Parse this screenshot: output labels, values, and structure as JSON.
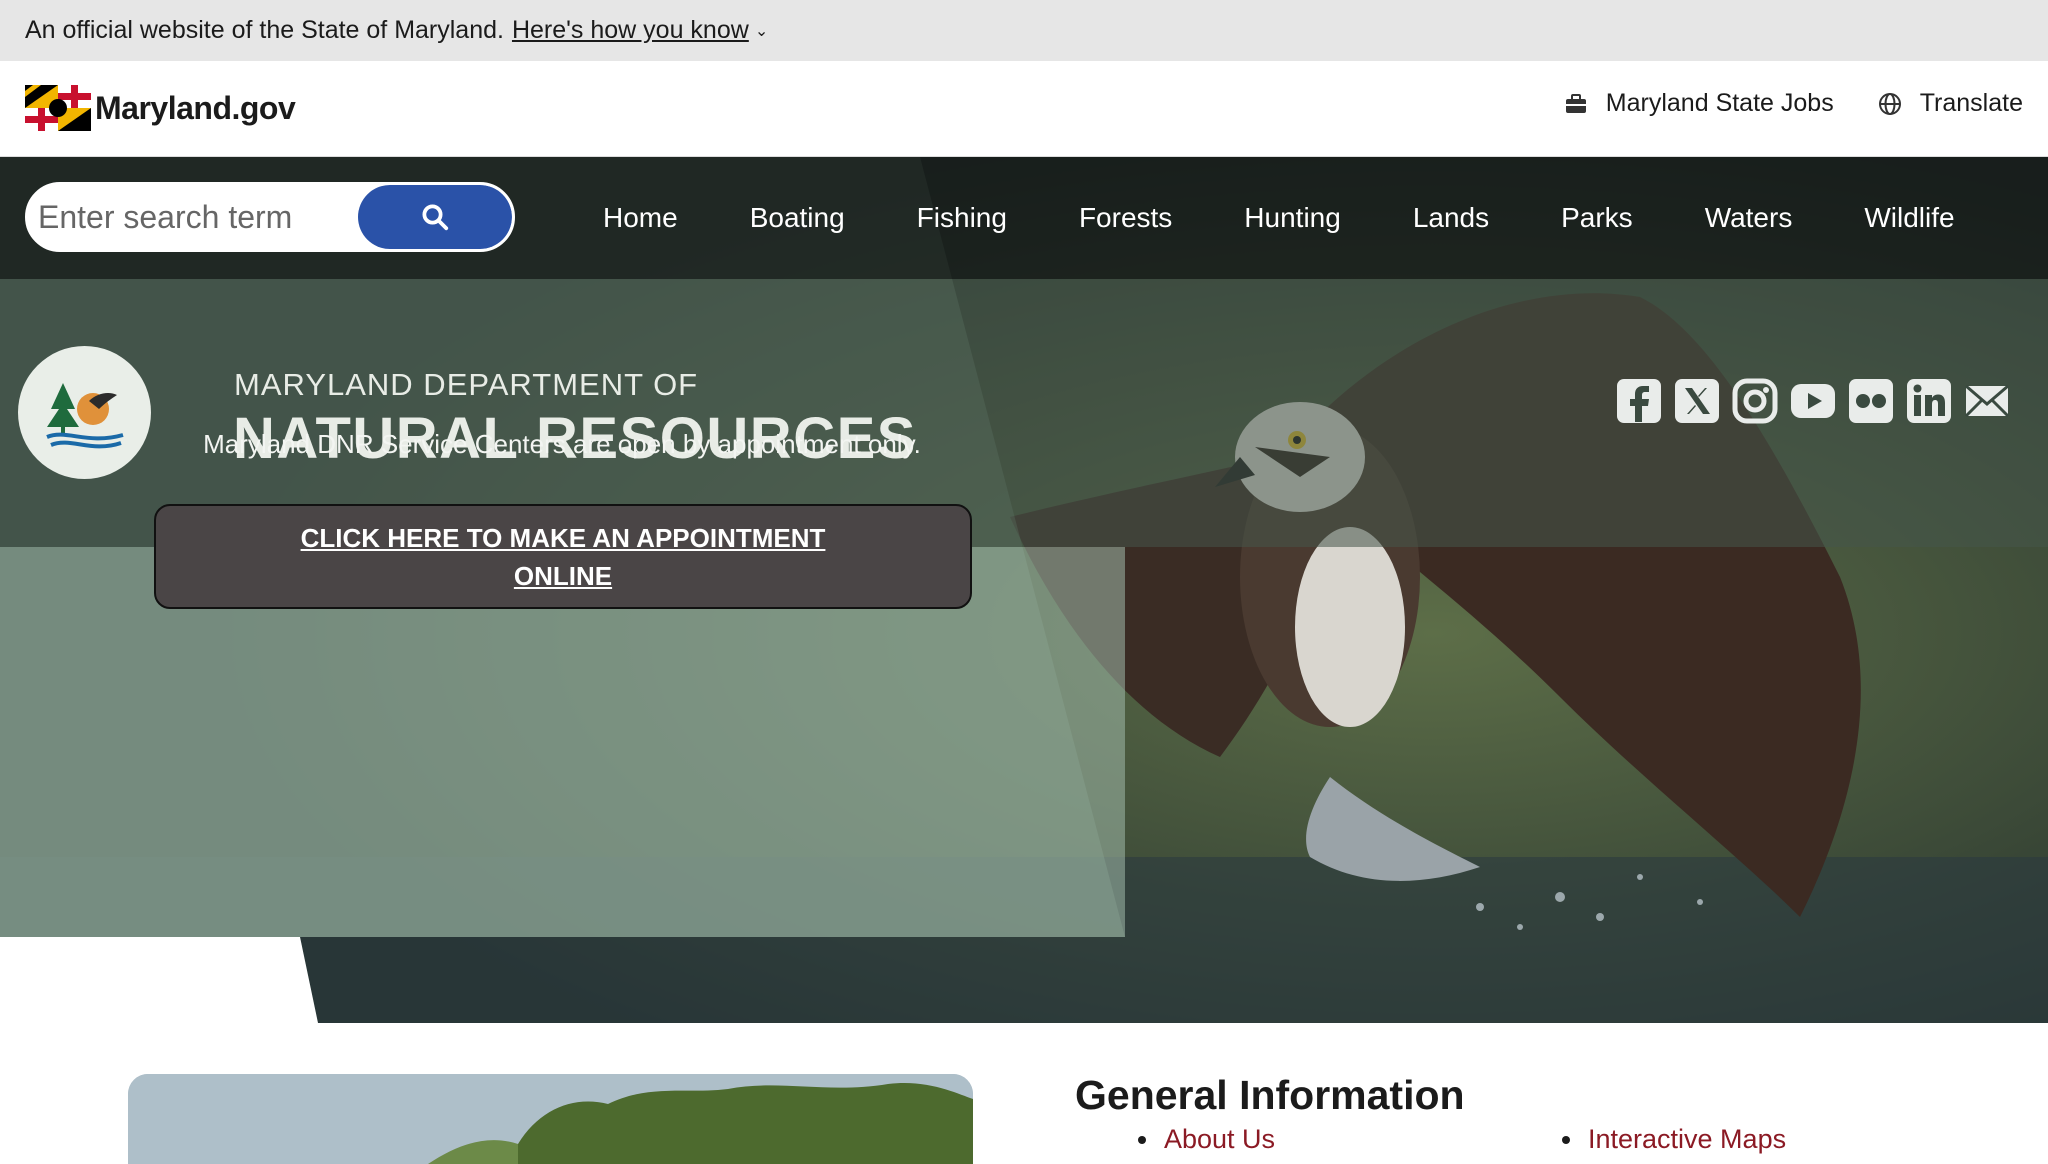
{
  "gov_banner": {
    "text": "An official website of the State of Maryland.",
    "link": "Here's how you know"
  },
  "header": {
    "logo_text": "Maryland.gov",
    "links": {
      "jobs": "Maryland State Jobs",
      "translate": "Translate"
    }
  },
  "search": {
    "placeholder": "Enter search term"
  },
  "nav": {
    "home": "Home",
    "boating": "Boating",
    "fishing": "Fishing",
    "forests": "Forests",
    "hunting": "Hunting",
    "lands": "Lands",
    "parks": "Parks",
    "waters": "Waters",
    "wildlife": "Wildlife"
  },
  "department": {
    "subtitle": "MARYLAND DEPARTMENT OF",
    "title": "NATURAL RESOURCES"
  },
  "social": [
    "facebook-icon",
    "x-icon",
    "instagram-icon",
    "youtube-icon",
    "flickr-icon",
    "linkedin-icon",
    "email-icon"
  ],
  "hero": {
    "notice": "Maryland DNR Service Centers are open by appointment only.",
    "button": "CLICK HERE TO MAKE AN APPOINTMENT ONLINE"
  },
  "general_info": {
    "title": "General Information",
    "col1": [
      "About Us"
    ],
    "col2": [
      "Interactive Maps"
    ]
  },
  "colors": {
    "accent_blue": "#2a52a8",
    "link_red": "#8b1a24",
    "banner_gray": "#e6e6e6"
  }
}
